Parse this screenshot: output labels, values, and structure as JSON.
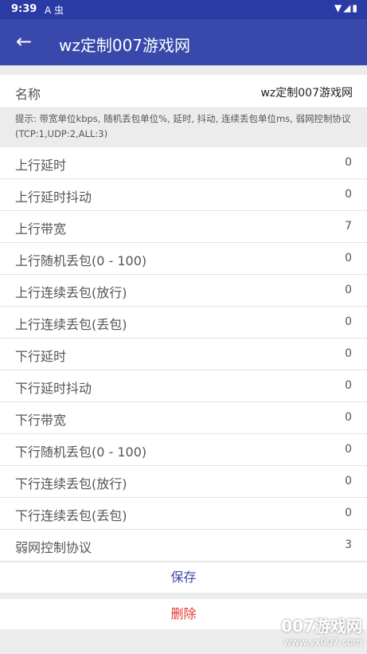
{
  "status_bar": {
    "time": "9:39",
    "notification_icons": "A 虫",
    "system_icons": "▼◢▮"
  },
  "appbar": {
    "back_icon": "←",
    "title": "wz定制007游戏网"
  },
  "name_field": {
    "label": "名称",
    "value": "wz定制007游戏网"
  },
  "hint": "提示: 带宽单位kbps, 随机丢包单位%, 延时, 抖动, 连续丢包单位ms, 弱网控制协议(TCP:1,UDP:2,ALL:3)",
  "settings": [
    {
      "label": "上行延时",
      "value": "0"
    },
    {
      "label": "上行延时抖动",
      "value": "0"
    },
    {
      "label": "上行带宽",
      "value": "7"
    },
    {
      "label": "上行随机丢包(0 - 100)",
      "value": "0"
    },
    {
      "label": "上行连续丢包(放行)",
      "value": "0"
    },
    {
      "label": "上行连续丢包(丢包)",
      "value": "0"
    },
    {
      "label": "下行延时",
      "value": "0"
    },
    {
      "label": "下行延时抖动",
      "value": "0"
    },
    {
      "label": "下行带宽",
      "value": "0"
    },
    {
      "label": "下行随机丢包(0 - 100)",
      "value": "0"
    },
    {
      "label": "下行连续丢包(放行)",
      "value": "0"
    },
    {
      "label": "下行连续丢包(丢包)",
      "value": "0"
    },
    {
      "label": "弱网控制协议",
      "value": "3"
    }
  ],
  "buttons": {
    "save": "保存",
    "delete": "删除"
  },
  "watermark": {
    "line1": "007游戏网",
    "line2": "www.yx007.com"
  },
  "colors": {
    "primary": "#3949ab",
    "status_bar": "#2b3ba6",
    "delete": "#e53935",
    "save": "#3b4aa8"
  }
}
